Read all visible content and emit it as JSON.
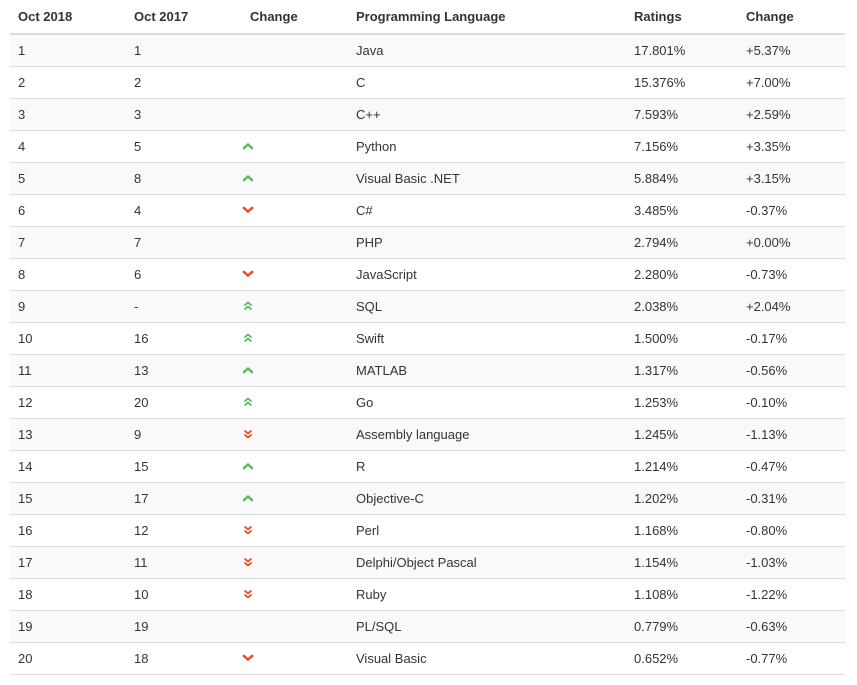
{
  "colors": {
    "up": "#5cb85c",
    "down": "#e84a1c",
    "stripe": "#f9f9f9",
    "border": "#dddddd"
  },
  "headers": [
    "Oct 2018",
    "Oct 2017",
    "Change",
    "Programming Language",
    "Ratings",
    "Change"
  ],
  "rows": [
    {
      "rank2018": "1",
      "rank2017": "1",
      "trend": "none",
      "language": "Java",
      "rating": "17.801%",
      "change": "+5.37%"
    },
    {
      "rank2018": "2",
      "rank2017": "2",
      "trend": "none",
      "language": "C",
      "rating": "15.376%",
      "change": "+7.00%"
    },
    {
      "rank2018": "3",
      "rank2017": "3",
      "trend": "none",
      "language": "C++",
      "rating": "7.593%",
      "change": "+2.59%"
    },
    {
      "rank2018": "4",
      "rank2017": "5",
      "trend": "up",
      "language": "Python",
      "rating": "7.156%",
      "change": "+3.35%"
    },
    {
      "rank2018": "5",
      "rank2017": "8",
      "trend": "up",
      "language": "Visual Basic .NET",
      "rating": "5.884%",
      "change": "+3.15%"
    },
    {
      "rank2018": "6",
      "rank2017": "4",
      "trend": "down",
      "language": "C#",
      "rating": "3.485%",
      "change": "-0.37%"
    },
    {
      "rank2018": "7",
      "rank2017": "7",
      "trend": "none",
      "language": "PHP",
      "rating": "2.794%",
      "change": "+0.00%"
    },
    {
      "rank2018": "8",
      "rank2017": "6",
      "trend": "down",
      "language": "JavaScript",
      "rating": "2.280%",
      "change": "-0.73%"
    },
    {
      "rank2018": "9",
      "rank2017": "-",
      "trend": "up-double",
      "language": "SQL",
      "rating": "2.038%",
      "change": "+2.04%"
    },
    {
      "rank2018": "10",
      "rank2017": "16",
      "trend": "up-double",
      "language": "Swift",
      "rating": "1.500%",
      "change": "-0.17%"
    },
    {
      "rank2018": "11",
      "rank2017": "13",
      "trend": "up",
      "language": "MATLAB",
      "rating": "1.317%",
      "change": "-0.56%"
    },
    {
      "rank2018": "12",
      "rank2017": "20",
      "trend": "up-double",
      "language": "Go",
      "rating": "1.253%",
      "change": "-0.10%"
    },
    {
      "rank2018": "13",
      "rank2017": "9",
      "trend": "down-double",
      "language": "Assembly language",
      "rating": "1.245%",
      "change": "-1.13%"
    },
    {
      "rank2018": "14",
      "rank2017": "15",
      "trend": "up",
      "language": "R",
      "rating": "1.214%",
      "change": "-0.47%"
    },
    {
      "rank2018": "15",
      "rank2017": "17",
      "trend": "up",
      "language": "Objective-C",
      "rating": "1.202%",
      "change": "-0.31%"
    },
    {
      "rank2018": "16",
      "rank2017": "12",
      "trend": "down-double",
      "language": "Perl",
      "rating": "1.168%",
      "change": "-0.80%"
    },
    {
      "rank2018": "17",
      "rank2017": "11",
      "trend": "down-double",
      "language": "Delphi/Object Pascal",
      "rating": "1.154%",
      "change": "-1.03%"
    },
    {
      "rank2018": "18",
      "rank2017": "10",
      "trend": "down-double",
      "language": "Ruby",
      "rating": "1.108%",
      "change": "-1.22%"
    },
    {
      "rank2018": "19",
      "rank2017": "19",
      "trend": "none",
      "language": "PL/SQL",
      "rating": "0.779%",
      "change": "-0.63%"
    },
    {
      "rank2018": "20",
      "rank2017": "18",
      "trend": "down",
      "language": "Visual Basic",
      "rating": "0.652%",
      "change": "-0.77%"
    }
  ]
}
